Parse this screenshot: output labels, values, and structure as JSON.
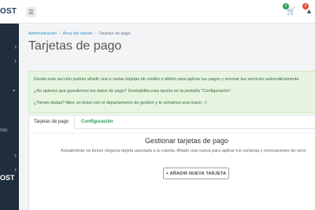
{
  "brand": {
    "logo_text": "OST",
    "sidebar_logo_text": "OST"
  },
  "topbar": {
    "menu_icon": "hamburger-icon",
    "cart_icon": "cart-icon",
    "cart_count": "0",
    "alert_icon": "warning-icon",
    "alert_count": "0",
    "colors": {
      "cart_badge": "#2e9e5b",
      "alert_badge": "#e04b3c"
    }
  },
  "sidebar": {
    "items": [
      {
        "icon": "chevron-right-icon"
      },
      {
        "icon": "chevron-right-icon"
      },
      {
        "icon": "chevron-down-icon"
      },
      {
        "label": "ítas"
      },
      {
        "icon": "chevron-right-icon"
      },
      {
        "icon": "chevron-right-icon"
      }
    ]
  },
  "breadcrumb": {
    "items": [
      "Administración",
      "Área del cliente",
      "Tarjetas de pago"
    ]
  },
  "page": {
    "title": "Tarjetas de pago"
  },
  "info": {
    "line1": "Desde esta sección podrás añadir una o varias tarjetas de crédito o débito para aplicar tus pagos y renovar tus servicios automáticamente.",
    "line2": "¿No quieres que guardemos tus datos de pago? Deshabilita esta opción en la pestaña \"Configuración\".",
    "line3": "¿Tienes dudas? Abre un ticket con el departamento de gestión y te echamos una mano :-)"
  },
  "tabs": [
    {
      "label": "Tarjetas de pago",
      "active": true
    },
    {
      "label": "Configuración",
      "active": false
    }
  ],
  "manage": {
    "title": "Gestionar tarjetas de pago",
    "text": "Actualmente no tienes ninguna tarjeta asociada a tu cuenta. Añade una nueva para aplicar tus compras y renovaciones de servi",
    "add_button": "+ AÑADIR NUEVA TARJETA"
  }
}
